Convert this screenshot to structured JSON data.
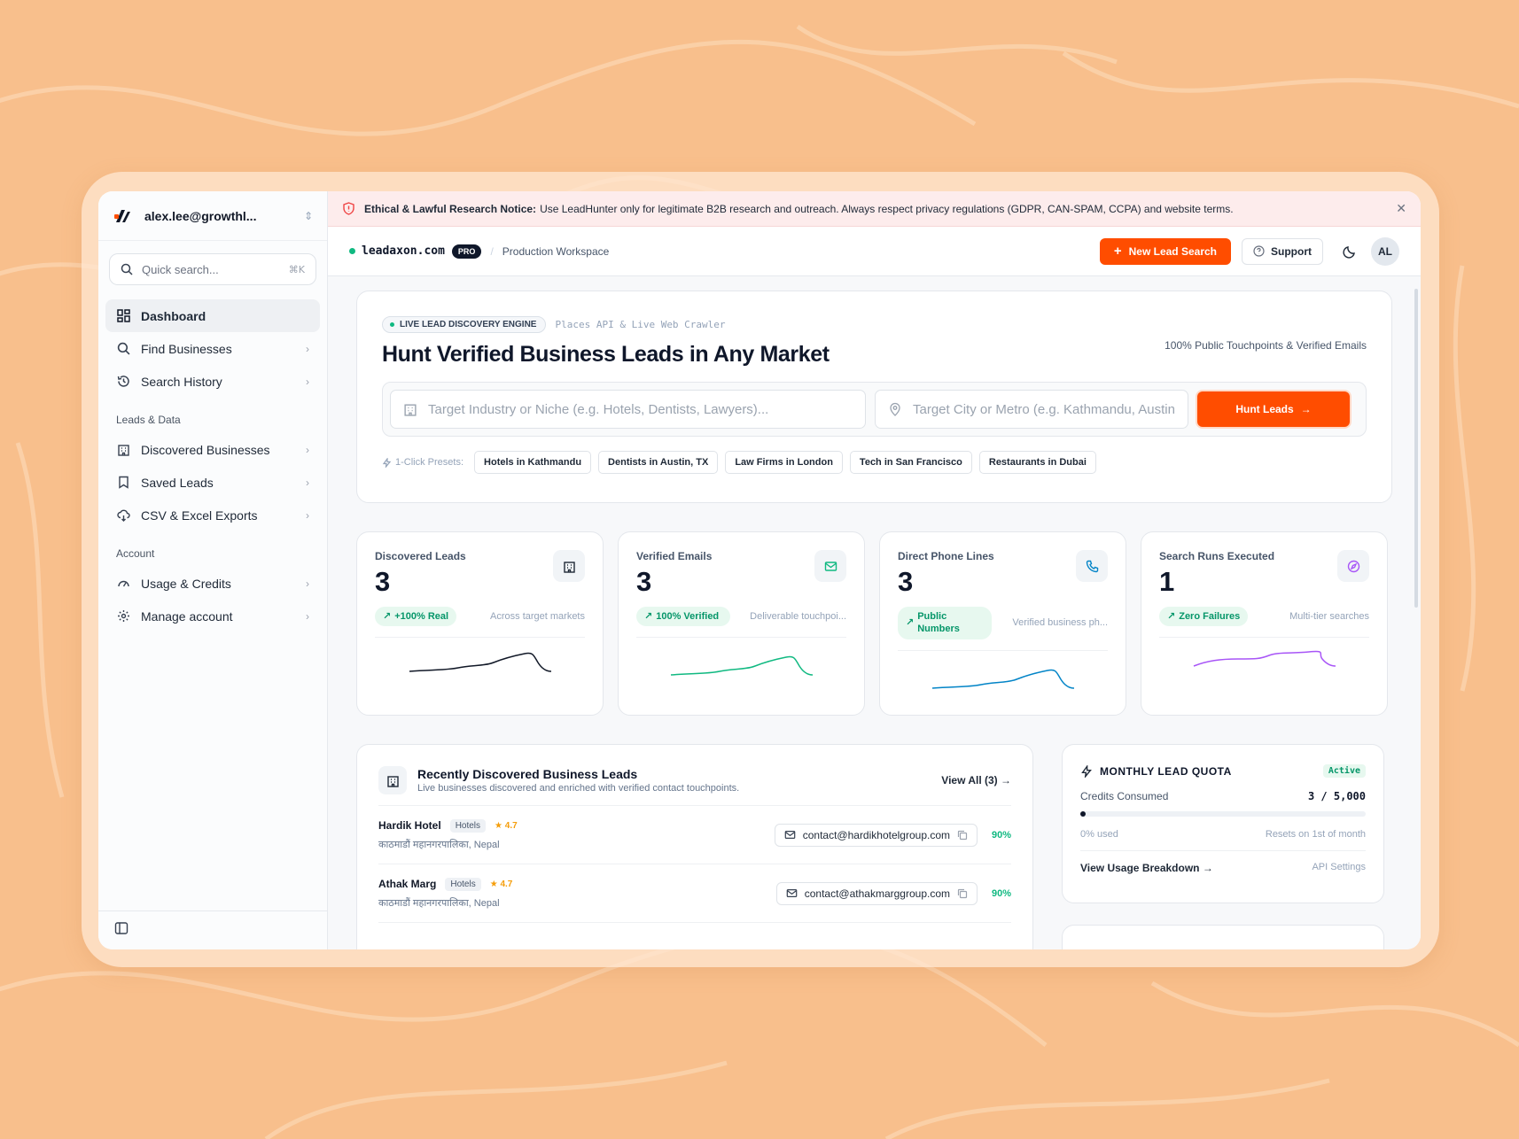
{
  "sidebar": {
    "account_email": "alex.lee@growthl...",
    "search_placeholder": "Quick search...",
    "search_shortcut": "⌘K",
    "items_main": [
      {
        "label": "Dashboard",
        "icon": "dashboard-icon",
        "active": true
      },
      {
        "label": "Find Businesses",
        "icon": "search-icon"
      },
      {
        "label": "Search History",
        "icon": "history-icon"
      }
    ],
    "section_leads": "Leads & Data",
    "items_leads": [
      {
        "label": "Discovered Businesses",
        "icon": "building-icon"
      },
      {
        "label": "Saved Leads",
        "icon": "bookmark-icon"
      },
      {
        "label": "CSV & Excel Exports",
        "icon": "cloud-download-icon"
      }
    ],
    "section_account": "Account",
    "items_account": [
      {
        "label": "Usage & Credits",
        "icon": "gauge-icon"
      },
      {
        "label": "Manage account",
        "icon": "gear-icon"
      }
    ]
  },
  "notice": {
    "title": "Ethical & Lawful Research Notice:",
    "text": "Use LeadHunter only for legitimate B2B research and outreach. Always respect privacy regulations (GDPR, CAN-SPAM, CCPA) and website terms."
  },
  "topbar": {
    "domain": "leadaxon.com",
    "plan": "PRO",
    "separator": "/",
    "workspace": "Production Workspace",
    "new_search": "New Lead Search",
    "support": "Support",
    "avatar": "AL"
  },
  "hero": {
    "engine_label": "LIVE LEAD DISCOVERY ENGINE",
    "api_label": "Places API & Live Web Crawler",
    "title": "Hunt Verified Business Leads in Any Market",
    "right_note": "100% Public Touchpoints & Verified Emails",
    "industry_placeholder": "Target Industry or Niche (e.g. Hotels, Dentists, Lawyers)...",
    "city_placeholder": "Target City or Metro (e.g. Kathmandu, Austin",
    "hunt_button": "Hunt Leads",
    "presets_label": "1-Click Presets:",
    "presets": [
      "Hotels in Kathmandu",
      "Dentists in Austin, TX",
      "Law Firms in London",
      "Tech in San Francisco",
      "Restaurants in Dubai"
    ]
  },
  "stats": [
    {
      "title": "Discovered Leads",
      "value": "3",
      "badge": "+100% Real",
      "note": "Across target markets",
      "icon": "building-icon",
      "color": "#111827"
    },
    {
      "title": "Verified Emails",
      "value": "3",
      "badge": "100% Verified",
      "note": "Deliverable touchpoi...",
      "icon": "mail-icon",
      "color": "#10b981"
    },
    {
      "title": "Direct Phone Lines",
      "value": "3",
      "badge": "Public Numbers",
      "note": "Verified business ph...",
      "icon": "phone-icon",
      "color": "#0284c7"
    },
    {
      "title": "Search Runs Executed",
      "value": "1",
      "badge": "Zero Failures",
      "note": "Multi-tier searches",
      "icon": "compass-icon",
      "color": "#a855f7"
    }
  ],
  "leads": {
    "title": "Recently Discovered Business Leads",
    "subtitle": "Live businesses discovered and enriched with verified contact touchpoints.",
    "view_all": "View All (3)",
    "rows": [
      {
        "name": "Hardik Hotel",
        "tag": "Hotels",
        "rating": "★ 4.7",
        "location": "काठमाडौं महानगरपालिका, Nepal",
        "email": "contact@hardikhotelgroup.com",
        "score": "90%"
      },
      {
        "name": "Athak Marg",
        "tag": "Hotels",
        "rating": "★ 4.7",
        "location": "काठमाडौं महानगरपालिका, Nepal",
        "email": "contact@athakmarggroup.com",
        "score": "90%"
      }
    ]
  },
  "quota": {
    "title": "MONTHLY LEAD QUOTA",
    "status": "Active",
    "consumed_label": "Credits Consumed",
    "consumed_value": "3 / 5,000",
    "used_fraction": 0.0006,
    "used_label": "0% used",
    "reset_label": "Resets on 1st of month",
    "breakdown_link": "View Usage Breakdown →",
    "api_settings": "API Settings"
  }
}
